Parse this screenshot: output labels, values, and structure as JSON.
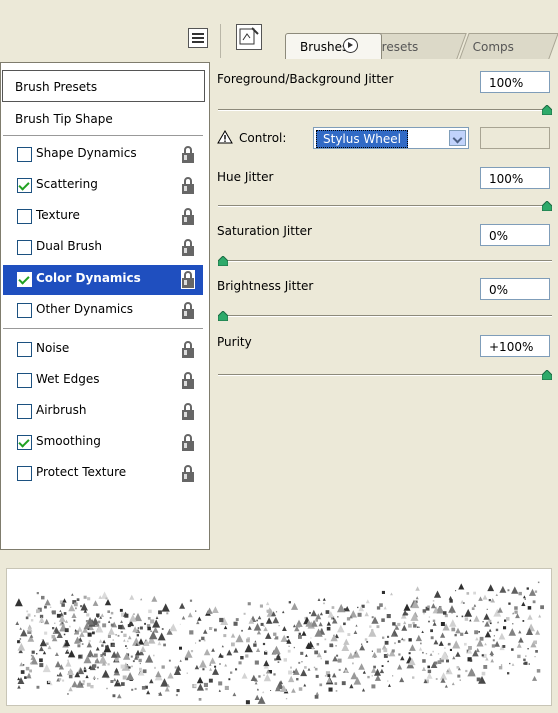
{
  "tabs": {
    "brushes": "Brushes",
    "presets": "Presets",
    "comps": "Comps"
  },
  "left": {
    "brush_presets": "Brush Presets",
    "brush_tip_shape": "Brush Tip Shape",
    "items": [
      {
        "label": "Shape Dynamics",
        "checked": false,
        "selected": false
      },
      {
        "label": "Scattering",
        "checked": true,
        "selected": false
      },
      {
        "label": "Texture",
        "checked": false,
        "selected": false
      },
      {
        "label": "Dual Brush",
        "checked": false,
        "selected": false
      },
      {
        "label": "Color Dynamics",
        "checked": true,
        "selected": true
      },
      {
        "label": "Other Dynamics",
        "checked": false,
        "selected": false
      },
      {
        "label": "Noise",
        "checked": false,
        "selected": false
      },
      {
        "label": "Wet Edges",
        "checked": false,
        "selected": false
      },
      {
        "label": "Airbrush",
        "checked": false,
        "selected": false
      },
      {
        "label": "Smoothing",
        "checked": true,
        "selected": false
      },
      {
        "label": "Protect Texture",
        "checked": false,
        "selected": false
      }
    ]
  },
  "right": {
    "fg_bg_jitter": {
      "label": "Foreground/Background Jitter",
      "value": "100%",
      "level": 1.0
    },
    "control": {
      "label": "Control:",
      "value": "Stylus Wheel"
    },
    "hue_jitter": {
      "label": "Hue Jitter",
      "value": "100%",
      "level": 1.0
    },
    "saturation_jitter": {
      "label": "Saturation Jitter",
      "value": "0%",
      "level": 0.0
    },
    "brightness_jitter": {
      "label": "Brightness Jitter",
      "value": "0%",
      "level": 0.0
    },
    "purity": {
      "label": "Purity",
      "value": "+100%",
      "level": 1.0
    }
  },
  "colors": {
    "panel": "#ECE9D8",
    "selection": "#1f4fbf",
    "check": "#21a121",
    "thumb": "#2eaa6a"
  }
}
